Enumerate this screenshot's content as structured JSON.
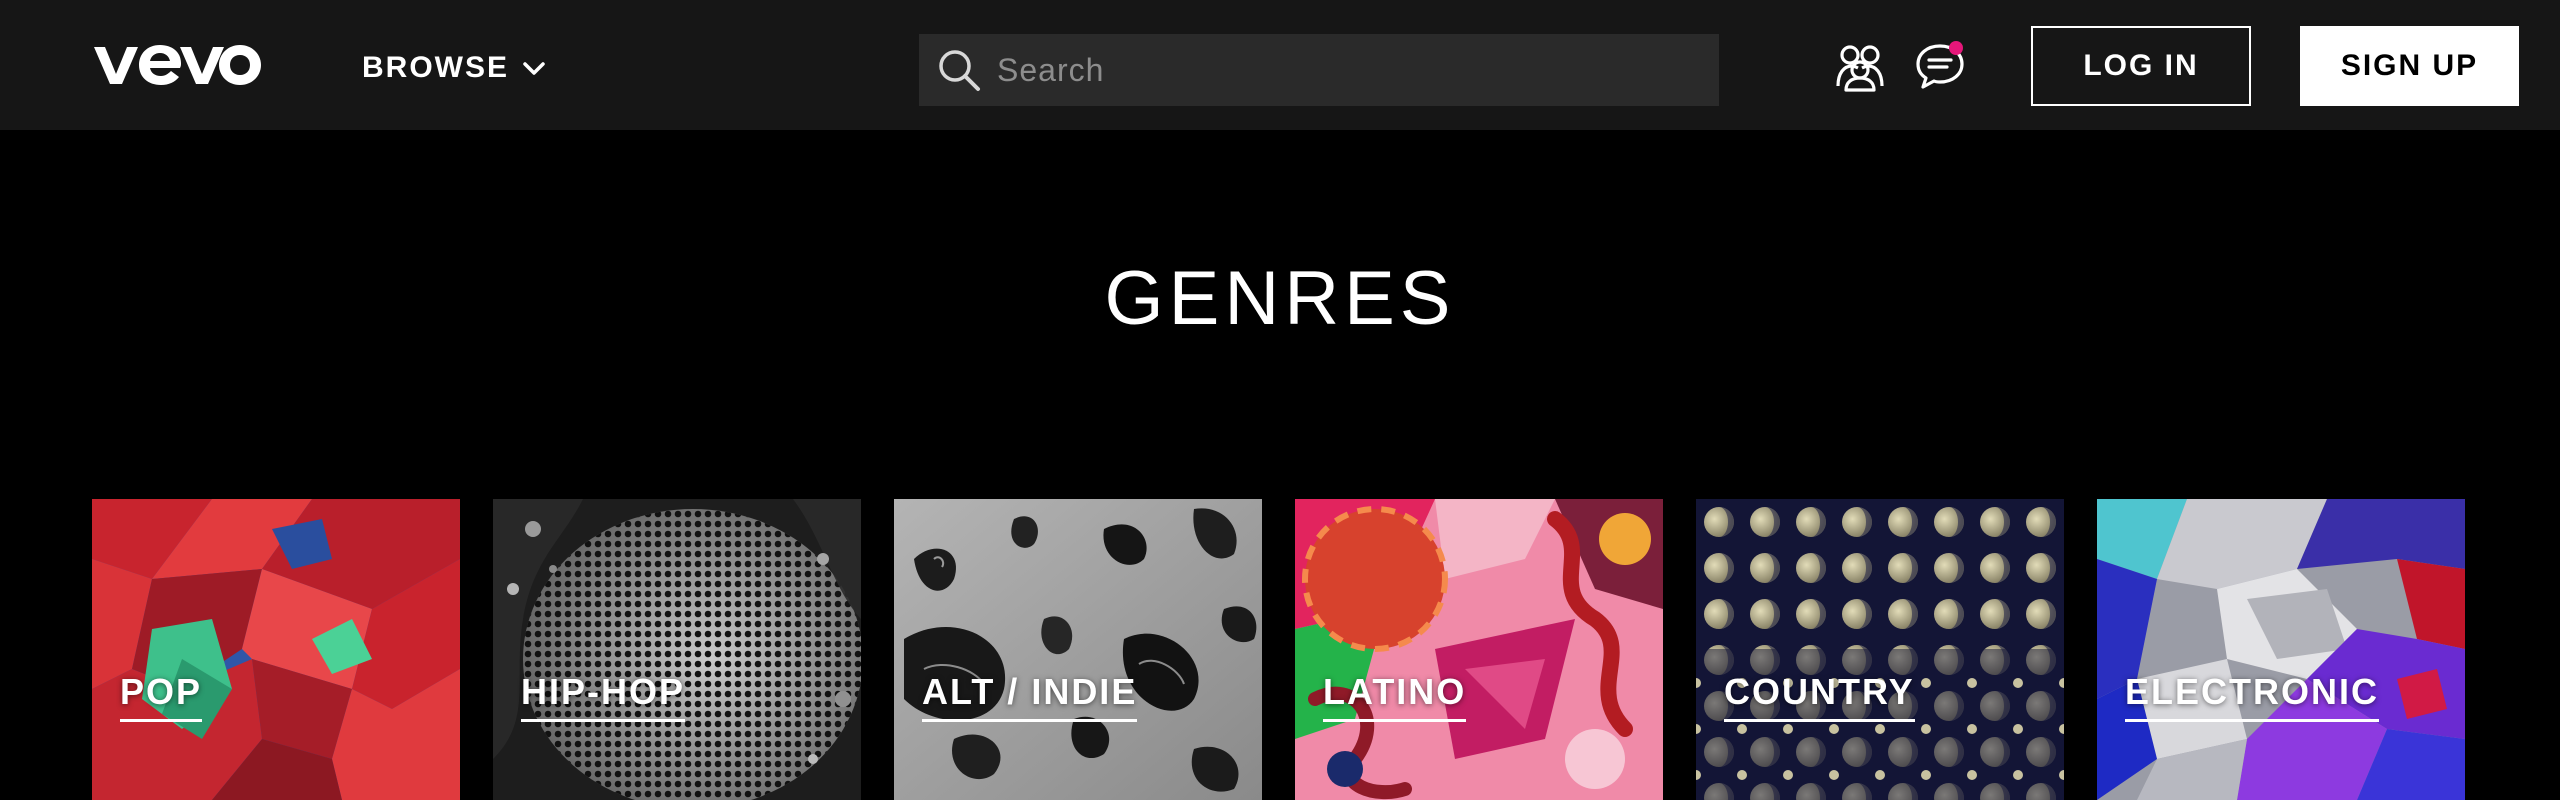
{
  "header": {
    "logo_text": "vevo",
    "browse_label": "BROWSE",
    "search": {
      "placeholder": "Search",
      "value": ""
    },
    "artists_icon": "artists-group-icon",
    "chat_icon": "chat-bubble-icon",
    "notification_color": "#e6177a",
    "login_label": "LOG IN",
    "signup_label": "SIGN UP"
  },
  "main": {
    "title": "GENRES",
    "genres": [
      {
        "label": "POP",
        "art": "red-blue-polygon-pattern"
      },
      {
        "label": "HIP-HOP",
        "art": "halftone-dot-pattern"
      },
      {
        "label": "ALT / INDIE",
        "art": "grey-marble-shards-pattern"
      },
      {
        "label": "LATINO",
        "art": "pink-abstract-3d-pattern"
      },
      {
        "label": "COUNTRY",
        "art": "navy-moon-dots-pattern"
      },
      {
        "label": "ELECTRONIC",
        "art": "chrome-purple-crystal-pattern"
      }
    ]
  },
  "colors": {
    "header_bg": "#161616",
    "page_bg": "#000000",
    "search_bg": "#2a2a2a"
  }
}
